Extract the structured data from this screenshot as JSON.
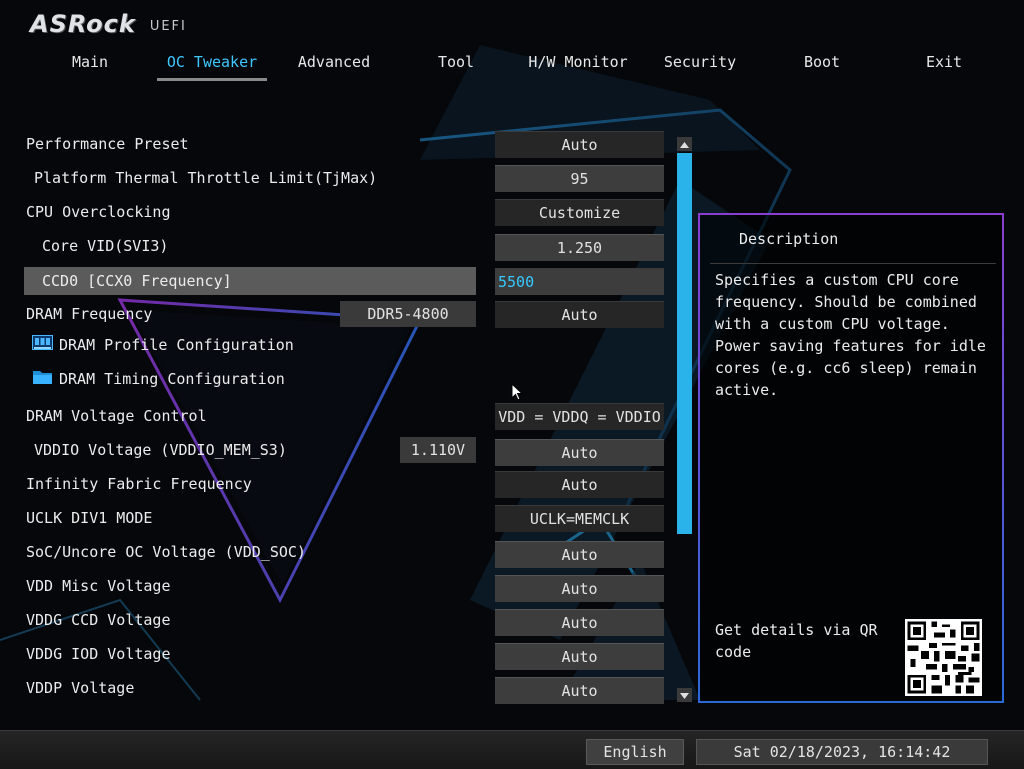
{
  "header": {
    "brand": "ASRock",
    "uefi": "UEFI"
  },
  "tabs": [
    {
      "label": "Main"
    },
    {
      "label": "OC Tweaker",
      "active": true
    },
    {
      "label": "Advanced"
    },
    {
      "label": "Tool"
    },
    {
      "label": "H/W Monitor"
    },
    {
      "label": "Security"
    },
    {
      "label": "Boot"
    },
    {
      "label": "Exit"
    }
  ],
  "settings": {
    "performance_preset": {
      "label": "Performance Preset",
      "value": "Auto"
    },
    "thermal_throttle": {
      "label": "Platform Thermal Throttle Limit(TjMax)",
      "value": "95"
    },
    "cpu_overclocking": {
      "label": "CPU Overclocking",
      "value": "Customize"
    },
    "core_vid": {
      "label": "Core VID(SVI3)",
      "value": "1.250"
    },
    "ccd0_freq": {
      "label": "CCD0 [CCX0 Frequency]",
      "value": "5500"
    },
    "dram_frequency": {
      "label": "DRAM Frequency",
      "readout": "DDR5-4800",
      "value": "Auto"
    },
    "dram_profile": {
      "label": "DRAM Profile Configuration",
      "icon": "memory-module-icon"
    },
    "dram_timing": {
      "label": "DRAM Timing Configuration",
      "icon": "folder-icon"
    },
    "dram_voltage_control": {
      "label": "DRAM Voltage Control",
      "value": "VDD = VDDQ = VDDIO"
    },
    "vddio_voltage": {
      "label": "VDDIO Voltage (VDDIO_MEM_S3)",
      "readout": "1.110V",
      "value": "Auto"
    },
    "infinity_fabric": {
      "label": "Infinity Fabric Frequency",
      "value": "Auto"
    },
    "uclk_div1": {
      "label": "UCLK DIV1 MODE",
      "value": "UCLK=MEMCLK"
    },
    "soc_voltage": {
      "label": "SoC/Uncore OC Voltage (VDD_SOC)",
      "value": "Auto"
    },
    "vdd_misc": {
      "label": "VDD Misc Voltage",
      "value": "Auto"
    },
    "vddg_ccd": {
      "label": "VDDG CCD Voltage",
      "value": "Auto"
    },
    "vddg_iod": {
      "label": "VDDG IOD Voltage",
      "value": "Auto"
    },
    "vddp": {
      "label": "VDDP Voltage",
      "value": "Auto"
    }
  },
  "description": {
    "title": "Description",
    "text": "Specifies a custom CPU core frequency. Should be combined with a custom CPU voltage. Power saving features for idle cores (e.g. cc6 sleep) remain active.",
    "qr_text": "Get details via QR code"
  },
  "footer": {
    "language": "English",
    "datetime": "Sat 02/18/2023, 16:14:42"
  },
  "colors": {
    "accent": "#2ab2ea",
    "active_tab": "#3ec8ff",
    "panel_border_top": "#8a3ed1",
    "panel_border_bottom": "#2a68d8"
  }
}
